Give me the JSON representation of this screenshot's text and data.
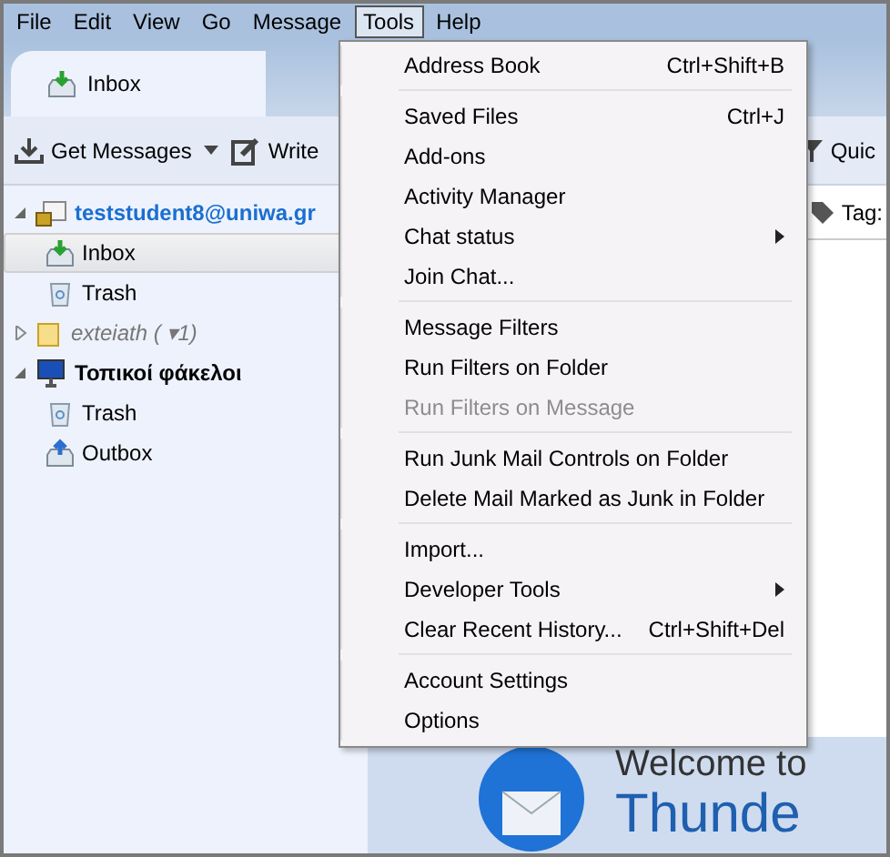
{
  "menu_bar": [
    {
      "label": "File",
      "selected": false
    },
    {
      "label": "Edit",
      "selected": false
    },
    {
      "label": "View",
      "selected": false
    },
    {
      "label": "Go",
      "selected": false
    },
    {
      "label": "Message",
      "selected": false
    },
    {
      "label": "Tools",
      "selected": true
    },
    {
      "label": "Help",
      "selected": false
    }
  ],
  "tabs": [
    {
      "label": "Inbox",
      "selected": true
    }
  ],
  "toolbar": {
    "get_messages": "Get Messages",
    "write": "Write",
    "quick_filter": "Quic",
    "tag": "Tag:"
  },
  "folders": [
    {
      "label": "teststudent8@uniwa.gr",
      "kind": "account",
      "expanded": true,
      "selected": false,
      "children": [
        {
          "label": "Inbox",
          "kind": "inbox",
          "selected": true
        },
        {
          "label": "Trash",
          "kind": "trash",
          "selected": false
        }
      ]
    },
    {
      "label": "exteiath ( ▾1)",
      "kind": "account-disabled",
      "expanded": false,
      "selected": false
    },
    {
      "label": "Τοπικοί φάκελοι",
      "kind": "local",
      "expanded": true,
      "selected": false,
      "children": [
        {
          "label": "Trash",
          "kind": "trash",
          "selected": false
        },
        {
          "label": "Outbox",
          "kind": "outbox",
          "selected": false
        }
      ]
    }
  ],
  "tools_menu": [
    {
      "kind": "item",
      "label": "Address Book",
      "shortcut": "Ctrl+Shift+B",
      "disabled": false
    },
    {
      "kind": "separator"
    },
    {
      "kind": "item",
      "label": "Saved Files",
      "shortcut": "Ctrl+J",
      "disabled": false
    },
    {
      "kind": "item",
      "label": "Add-ons",
      "disabled": false
    },
    {
      "kind": "item",
      "label": "Activity Manager",
      "disabled": false
    },
    {
      "kind": "submenu",
      "label": "Chat status",
      "disabled": false
    },
    {
      "kind": "item",
      "label": "Join Chat...",
      "disabled": false
    },
    {
      "kind": "separator"
    },
    {
      "kind": "item",
      "label": "Message Filters",
      "disabled": false
    },
    {
      "kind": "item",
      "label": "Run Filters on Folder",
      "disabled": false
    },
    {
      "kind": "item",
      "label": "Run Filters on Message",
      "disabled": true
    },
    {
      "kind": "separator"
    },
    {
      "kind": "item",
      "label": "Run Junk Mail Controls on Folder",
      "disabled": false
    },
    {
      "kind": "item",
      "label": "Delete Mail Marked as Junk in Folder",
      "disabled": false
    },
    {
      "kind": "separator"
    },
    {
      "kind": "item",
      "label": "Import...",
      "disabled": false
    },
    {
      "kind": "submenu",
      "label": "Developer Tools",
      "disabled": false
    },
    {
      "kind": "item",
      "label": "Clear Recent History...",
      "shortcut": "Ctrl+Shift+Del",
      "disabled": false
    },
    {
      "kind": "separator"
    },
    {
      "kind": "item",
      "label": "Account Settings",
      "disabled": false
    },
    {
      "kind": "item",
      "label": "Options",
      "disabled": false
    }
  ],
  "welcome": {
    "line_1": "Welcome to",
    "line_2": "Thunde"
  }
}
